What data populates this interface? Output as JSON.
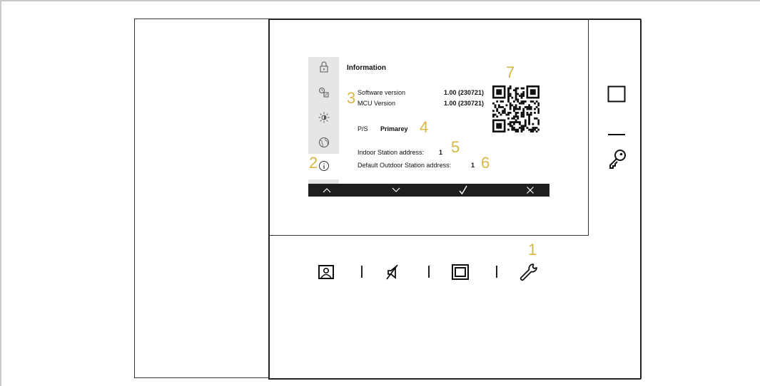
{
  "display": {
    "title": "Information",
    "software_label": "Software version",
    "software_value": "1.00 (230721)",
    "mcu_label": "MCU Version",
    "mcu_value": "1.00 (230721)",
    "ps_label": "P/S",
    "ps_value": "Primarey",
    "indoor_label": "Indoor Station address:",
    "indoor_value": "1",
    "outdoor_label": "Default Outdoor Station address:",
    "outdoor_value": "1",
    "sidebar_icons": [
      "lock-icon",
      "clock-icon",
      "brightness-icon",
      "globe-icon",
      "info-icon"
    ],
    "bottom_nav": [
      "up-chevron-icon",
      "down-chevron-icon",
      "check-icon",
      "close-icon"
    ]
  },
  "callouts": {
    "c1": "1",
    "c2": "2",
    "c3": "3",
    "c4": "4",
    "c5": "5",
    "c6": "6",
    "c7": "7"
  },
  "device_buttons": [
    "portrait-icon",
    "mute-icon",
    "square-icon",
    "wrench-icon"
  ],
  "side_buttons": [
    "square-icon",
    "dash-icon",
    "key-icon"
  ],
  "colors": {
    "callout": "#d8b642",
    "display_bar": "#1e1e1e",
    "sidebar": "#e6e6e6"
  }
}
